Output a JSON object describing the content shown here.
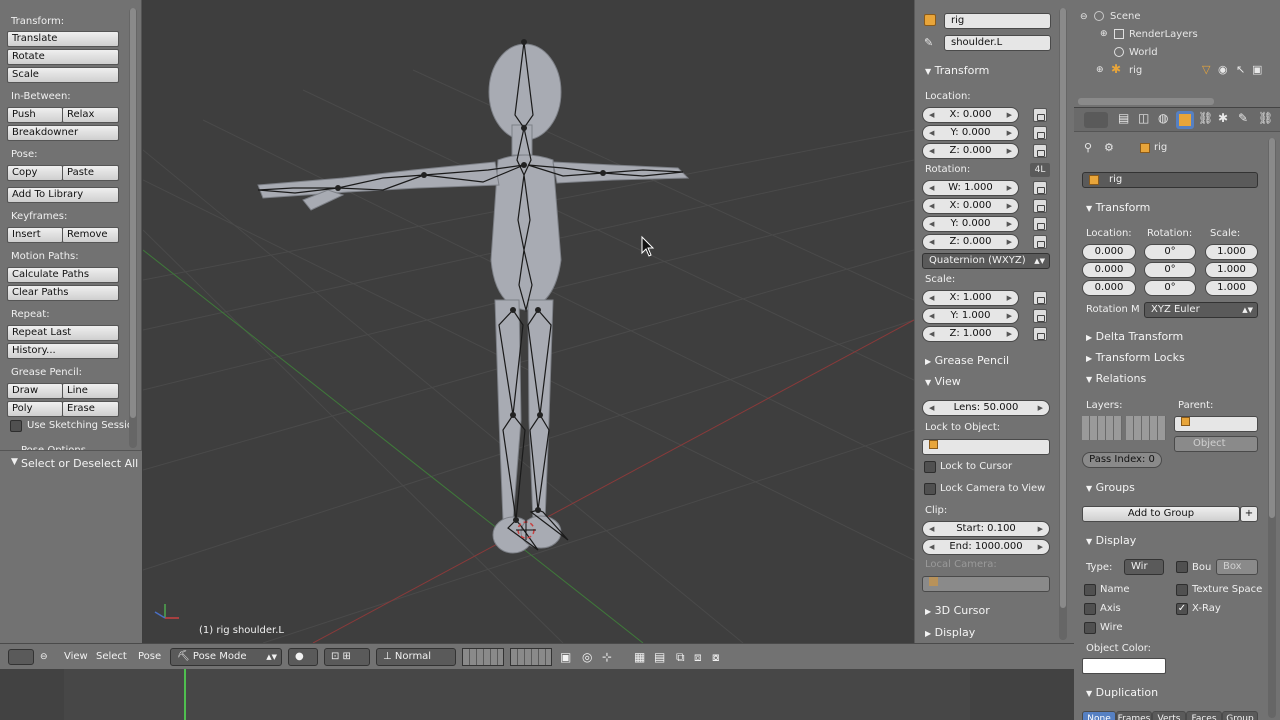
{
  "toolshelf": {
    "transform_label": "Transform:",
    "translate": "Translate",
    "rotate": "Rotate",
    "scale": "Scale",
    "inbetween_label": "In-Between:",
    "push": "Push",
    "relax": "Relax",
    "breakdowner": "Breakdowner",
    "pose_label": "Pose:",
    "copy": "Copy",
    "paste": "Paste",
    "add_to_library": "Add To Library",
    "keyframes_label": "Keyframes:",
    "insert": "Insert",
    "remove": "Remove",
    "motion_paths_label": "Motion Paths:",
    "calculate_paths": "Calculate Paths",
    "clear_paths": "Clear Paths",
    "repeat_label": "Repeat:",
    "repeat_last": "Repeat Last",
    "history": "History...",
    "grease_pencil_label": "Grease Pencil:",
    "draw": "Draw",
    "line": "Line",
    "poly": "Poly",
    "erase": "Erase",
    "use_sketching": "Use Sketching Sessio",
    "pose_options_partial": "Pose Options",
    "operator_panel": "Select or Deselect All"
  },
  "viewport": {
    "status": "(1) rig shoulder.L"
  },
  "npanel": {
    "object_name": "rig",
    "bone_name": "shoulder.L",
    "transform_header": "Transform",
    "location_label": "Location:",
    "loc_x": "X: 0.000",
    "loc_y": "Y: 0.000",
    "loc_z": "Z: 0.000",
    "rotation_label": "Rotation:",
    "rot_4l": "4L",
    "rot_w": "W: 1.000",
    "rot_x": "X: 0.000",
    "rot_y": "Y: 0.000",
    "rot_z": "Z: 0.000",
    "rotation_mode": "Quaternion (WXYZ)",
    "scale_label": "Scale:",
    "scale_x": "X: 1.000",
    "scale_y": "Y: 1.000",
    "scale_z": "Z: 1.000",
    "grease_pencil_header": "Grease Pencil",
    "view_header": "View",
    "lens": "Lens: 50.000",
    "lock_to_object": "Lock to Object:",
    "lock_to_cursor": "Lock to Cursor",
    "lock_camera_to_view": "Lock Camera to View",
    "clip_label": "Clip:",
    "clip_start": "Start: 0.100",
    "clip_end": "End: 1000.000",
    "local_camera": "Local Camera:",
    "cursor_header": "3D Cursor",
    "display_header": "Display"
  },
  "outliner": {
    "scene": "Scene",
    "render_layers": "RenderLayers",
    "world": "World",
    "rig": "rig"
  },
  "properties": {
    "breadcrumb": "rig",
    "object_name": "rig",
    "transform_header": "Transform",
    "location_label": "Location:",
    "rotation_label": "Rotation:",
    "scale_label": "Scale:",
    "loc": [
      "0.000",
      "0.000",
      "0.000"
    ],
    "rot": [
      "0°",
      "0°",
      "0°"
    ],
    "scale": [
      "1.000",
      "1.000",
      "1.000"
    ],
    "rotation_mode_label": "Rotation M",
    "rotation_mode": "XYZ Euler",
    "delta_transform": "Delta Transform",
    "transform_locks": "Transform Locks",
    "relations": "Relations",
    "layers_label": "Layers:",
    "parent_label": "Parent:",
    "parent_type": "Object",
    "pass_index": "Pass Index: 0",
    "groups": "Groups",
    "add_to_group": "Add to Group",
    "display": "Display",
    "type_label": "Type:",
    "type_value": "Wir",
    "bounds": "Bou",
    "bounds_type": "Box",
    "name": "Name",
    "texture_space": "Texture Space",
    "axis": "Axis",
    "xray": "X-Ray",
    "wire": "Wire",
    "object_color": "Object Color:",
    "duplication": "Duplication",
    "dup_tabs": [
      "None",
      "Frames",
      "Verts",
      "Faces",
      "Group"
    ]
  },
  "header": {
    "view": "View",
    "select": "Select",
    "pose": "Pose",
    "mode": "Pose Mode",
    "pivot": "Normal"
  },
  "colors": {
    "panel": "#727272",
    "viewport": "#3e3e3e",
    "accent_blue": "#5680c2",
    "grid_red": "#8a3a3a",
    "grid_green": "#3f7a3a",
    "timeline_cursor": "#4fbf4f"
  }
}
